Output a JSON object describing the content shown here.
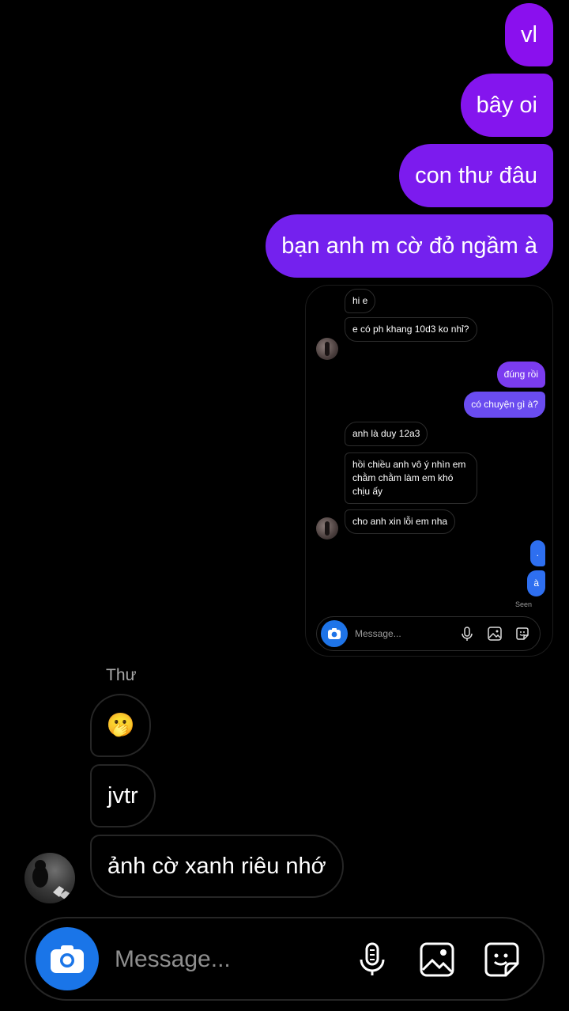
{
  "outgoing_messages": [
    "vl",
    "bây oi",
    "con thư đâu",
    "bạn anh m cờ đỏ ngầm à"
  ],
  "shared_screenshot": {
    "messages": [
      {
        "from": "them",
        "text": "hi e"
      },
      {
        "from": "them",
        "text": "e có ph khang 10d3 ko nhỉ?"
      },
      {
        "from": "me",
        "text": "đúng rồi"
      },
      {
        "from": "me",
        "text": "có chuyện gì à?"
      },
      {
        "from": "them",
        "text": "anh là duy 12a3"
      },
      {
        "from": "them",
        "text": "hồi chiều anh vô ý nhìn em chằm chằm làm em khó chịu ấy"
      },
      {
        "from": "them",
        "text": "cho anh xin lỗi em nha"
      },
      {
        "from": "me",
        "text": "."
      },
      {
        "from": "me",
        "text": "à"
      }
    ],
    "seen_label": "Seen",
    "composer_placeholder": "Message..."
  },
  "incoming": {
    "sender_name": "Thư",
    "messages": [
      "🫢",
      "jvtr",
      "ảnh cờ xanh riêu nhớ"
    ]
  },
  "composer": {
    "placeholder": "Message...",
    "icons": [
      "camera-icon",
      "microphone-icon",
      "gallery-icon",
      "sticker-icon"
    ]
  },
  "colors": {
    "outgoing_bubble": "#8a10ee",
    "screenshot_outgoing_purple": "#7b3cf0",
    "screenshot_outgoing_blue": "#2e6ff0",
    "camera_button": "#1a75e8"
  }
}
